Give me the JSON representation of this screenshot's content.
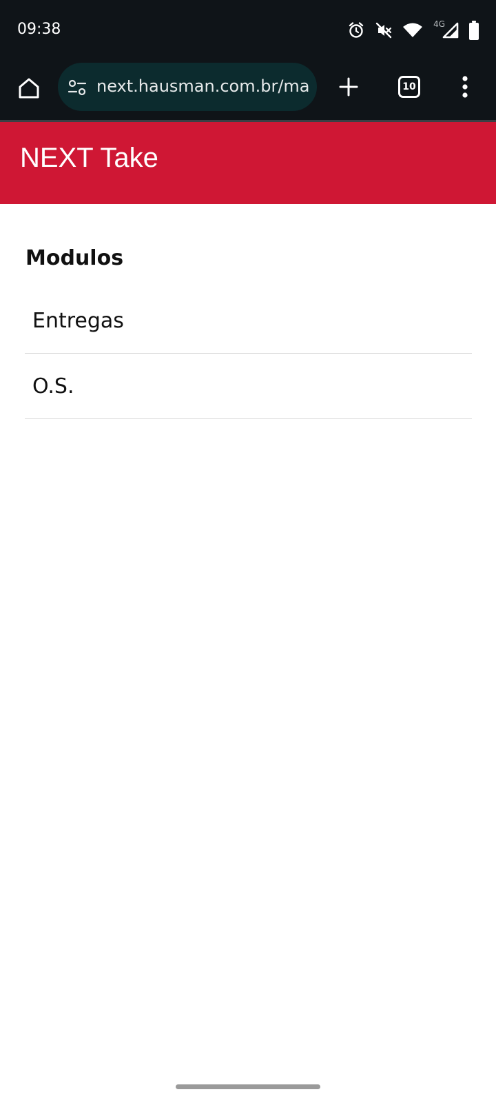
{
  "status_bar": {
    "time": "09:38",
    "network_type": "4G",
    "icons": [
      "alarm-icon",
      "vibrate-off-icon",
      "wifi-icon",
      "signal-icon",
      "battery-icon"
    ]
  },
  "browser": {
    "url": "next.hausman.com.br/ma",
    "tab_count": "10",
    "icons": [
      "home-icon",
      "site-settings-icon",
      "plus-icon",
      "more-vert-icon"
    ]
  },
  "app": {
    "title": "NEXT Take",
    "header_color": "#cf1734"
  },
  "content": {
    "section_title": "Modulos",
    "modules": [
      {
        "label": "Entregas"
      },
      {
        "label": "O.S."
      }
    ]
  }
}
